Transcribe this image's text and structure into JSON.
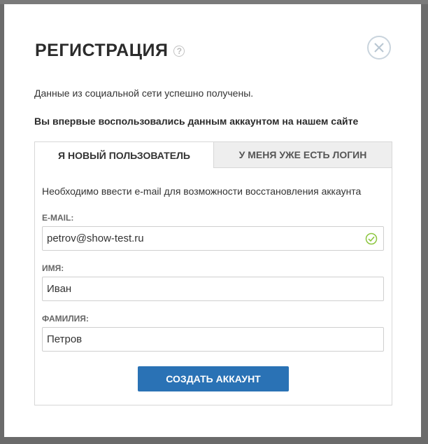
{
  "modal": {
    "title": "РЕГИСТРАЦИЯ",
    "help_icon_glyph": "?",
    "success_message": "Данные из социальной сети успешно получены.",
    "first_time_message": "Вы впервые воспользовались данным аккаунтом на нашем сайте"
  },
  "tabs": [
    {
      "label": "Я НОВЫЙ ПОЛЬЗОВАТЕЛЬ",
      "active": true
    },
    {
      "label": "У МЕНЯ УЖЕ ЕСТЬ ЛОГИН",
      "active": false
    }
  ],
  "form": {
    "hint": "Необходимо ввести e-mail для возможности восстановления аккаунта",
    "email_label": "E-MAIL:",
    "email_value": "petrov@show-test.ru",
    "email_valid": true,
    "first_name_label": "ИМЯ:",
    "first_name_value": "Иван",
    "last_name_label": "ФАМИЛИЯ:",
    "last_name_value": "Петров",
    "submit_label": "СОЗДАТЬ АККАУНТ"
  },
  "colors": {
    "primary_button": "#2a72b5",
    "valid_check": "#8cc63f",
    "overlay": "#6b6b6b"
  },
  "icons": {
    "close": "close-icon",
    "help": "help-icon",
    "valid": "check-circle-icon"
  }
}
